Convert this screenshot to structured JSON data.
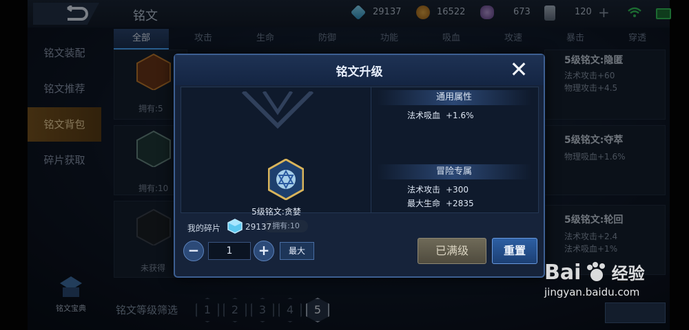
{
  "app": {
    "title": "铭文"
  },
  "resources": [
    {
      "icon": "crystal-icon",
      "value": "29137",
      "color": "#4fb1d6"
    },
    {
      "icon": "gold-coin-icon",
      "value": "16522",
      "color": "#c9872e"
    },
    {
      "icon": "gem-pile-icon",
      "value": "673",
      "color": "#8a66b0"
    },
    {
      "icon": "scroll-icon",
      "value": "120",
      "color": "#8c99aa"
    }
  ],
  "tabs": [
    {
      "label": "全部",
      "active": true
    },
    {
      "label": "攻击"
    },
    {
      "label": "生命"
    },
    {
      "label": "防御"
    },
    {
      "label": "功能"
    },
    {
      "label": "吸血"
    },
    {
      "label": "攻速"
    },
    {
      "label": "暴击"
    },
    {
      "label": "穿透"
    }
  ],
  "sidebar": {
    "items": [
      {
        "label": "铭文装配"
      },
      {
        "label": "铭文推荐"
      },
      {
        "label": "铭文背包",
        "active": true
      },
      {
        "label": "碎片获取"
      }
    ],
    "codex_label": "铭文宝典"
  },
  "background_cards": {
    "left": [
      {
        "owned": "拥有:5"
      },
      {
        "owned": "拥有:10"
      },
      {
        "owned": "未获得"
      }
    ],
    "right": [
      {
        "title": "5级铭文:隐匿",
        "stats": [
          "法术攻击+60",
          "物理攻击+4.5"
        ]
      },
      {
        "title": "5级铭文:夺萃",
        "stats": [
          "物理吸血+1.6%"
        ]
      },
      {
        "title": "5级铭文:轮回",
        "stats": [
          "法术攻击+2.4",
          "法术吸血+1%"
        ]
      }
    ]
  },
  "filter": {
    "label": "铭文等级筛选",
    "levels": [
      "1",
      "2",
      "3",
      "4",
      "5"
    ],
    "selected": "5"
  },
  "dialog": {
    "title": "铭文升级",
    "close_symbol": "✕",
    "rune": {
      "name": "5级铭文:贪婪",
      "owned": "拥有:10"
    },
    "general": {
      "heading": "通用属性",
      "stats": [
        {
          "key": "法术吸血",
          "value": "+1.6%"
        }
      ]
    },
    "adventure": {
      "heading": "冒险专属",
      "stats": [
        {
          "key": "法术攻击",
          "value": "+300"
        },
        {
          "key": "最大生命",
          "value": "+2835"
        }
      ]
    },
    "fragments": {
      "label": "我的碎片",
      "value": "29137"
    },
    "quantity": {
      "minus": "−",
      "value": "1",
      "plus": "+",
      "max_label": "最大"
    },
    "buttons": {
      "maxed": "已满级",
      "reset": "重置"
    }
  },
  "watermark": {
    "brand": "Bai",
    "brand2": "经验",
    "url": "jingyan.baidu.com"
  }
}
